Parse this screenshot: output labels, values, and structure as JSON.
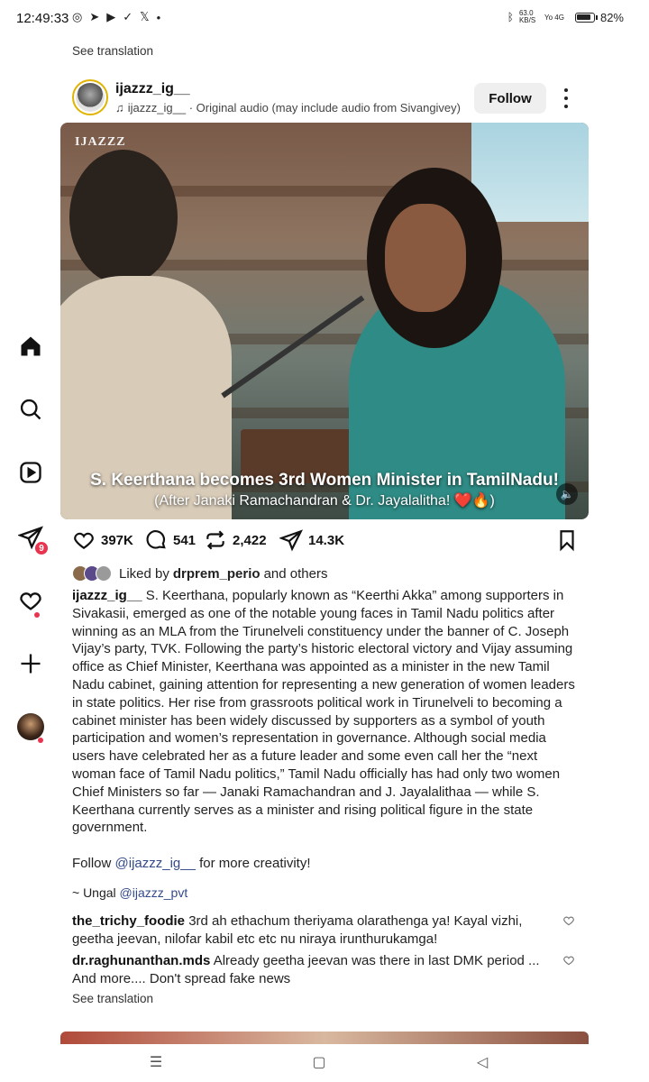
{
  "status_bar": {
    "time": "12:49:33",
    "net_speed": "63.0 KB/S",
    "network": "Yo 4G",
    "battery": "82%"
  },
  "top_see_translation": "See translation",
  "post": {
    "username": "ijazzz_ig__",
    "audio_user": "ijazzz_ig__",
    "audio_text": " · Original audio (may include audio from Sivangivey)",
    "follow_label": "Follow",
    "media": {
      "watermark": "IJAZZZ",
      "caption_line1": "S. Keerthana becomes 3rd Women Minister in TamilNadu!",
      "caption_line2": "(After Janaki Ramachandran & Dr. Jayalalitha! ❤️🔥)"
    },
    "actions": {
      "likes": "397K",
      "comments": "541",
      "reposts": "2,422",
      "shares": "14.3K"
    },
    "liked_by": {
      "prefix": "Liked by",
      "user": "drprem_perio",
      "suffix": "and others"
    },
    "caption": {
      "user": "ijazzz_ig__",
      "body": " S. Keerthana, popularly known as “Keerthi Akka” among supporters in Sivakasii, emerged as one of the notable young faces in Tamil Nadu politics after winning as an MLA from the Tirunelveli constituency under the banner of C. Joseph Vijay’s party, TVK. Following the party’s historic electoral victory and Vijay assuming office as Chief Minister, Keerthana was appointed as a minister in the new Tamil Nadu cabinet, gaining attention for representing a new generation of women leaders in state politics. Her rise from grassroots political work in Tirunelveli to becoming a cabinet minister has been widely discussed by supporters as a symbol of youth participation and women’s representation in governance. Although social media users have celebrated her as a future leader and some even call her the “next woman face of Tamil Nadu politics,” Tamil Nadu officially has had only two women Chief Ministers so far — Janaki Ramachandran and J. Jayalalithaa — while S. Keerthana currently serves as a minister and rising political figure in the state government.",
      "follow_prefix": "Follow ",
      "follow_link": "@ijazzz_ig__",
      "follow_suffix": " for more creativity!",
      "ungal_prefix": "~ Ungal ",
      "ungal_link": "@ijazzz_pvt"
    },
    "comments": [
      {
        "user": "the_trichy_foodie",
        "text": " 3rd ah ethachum theriyama olarathenga ya! Kayal vizhi, geetha jeevan, nilofar kabil etc etc nu niraya irunthurukamga!"
      },
      {
        "user": "dr.raghunanthan.mds",
        "text": " Already geetha jeevan was there in last DMK period ... And more.... Don't spread fake news"
      }
    ],
    "see_translation": "See translation"
  },
  "sidebar": {
    "messages_badge": "9"
  }
}
